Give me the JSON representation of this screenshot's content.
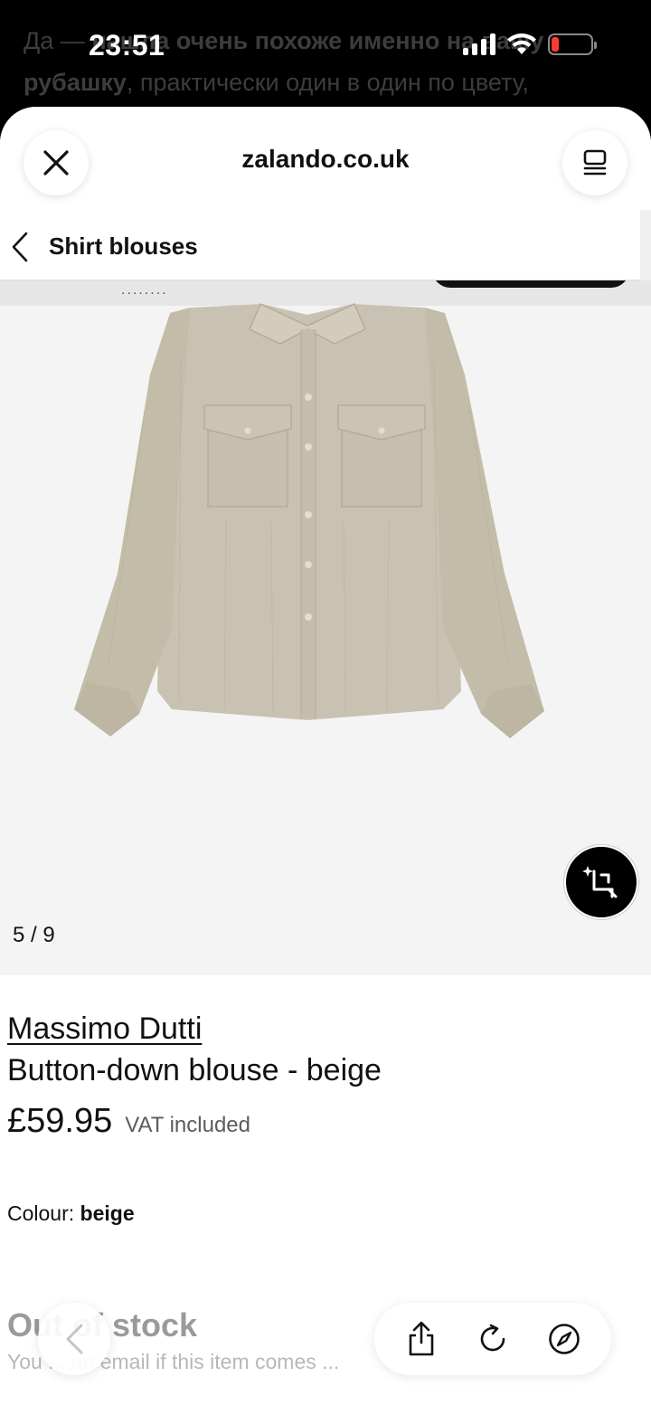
{
  "status_bar": {
    "time": "23:51"
  },
  "background_chat": {
    "line1_start": "Да — ",
    "line1_rest": "нашла очень похоже именно на вашу",
    "line2_bold": "рубашку",
    "line2_rest": ", практически один в один по цвету,"
  },
  "sheet": {
    "site_title": "zalando.co.uk",
    "close_icon": "close-icon",
    "menu_icon": "reader-menu-icon"
  },
  "breadcrumb": {
    "label": "Shirt blouses"
  },
  "gallery": {
    "counter": "5 / 9",
    "ai_button_icon": "ai-crop-search-icon",
    "top_strip_text": "........"
  },
  "product": {
    "brand": "Massimo Dutti",
    "name": "Button-down blouse - beige",
    "price": "£59.95",
    "vat": "VAT included",
    "colour_label": "Colour:",
    "colour_value": "beige",
    "stock_title": "Out of stock",
    "stock_note": "You ... an email if this item comes ..."
  },
  "colors": {
    "accent": "#000000",
    "background": "#ffffff",
    "gallery_bg": "#f4f4f4",
    "shirt": "#c9c2b2",
    "battery_low": "#ff3b30"
  },
  "browser_toolbar": {
    "back_icon": "chevron-left-icon",
    "share_icon": "share-icon",
    "reload_icon": "reload-icon",
    "compass_icon": "compass-icon"
  }
}
